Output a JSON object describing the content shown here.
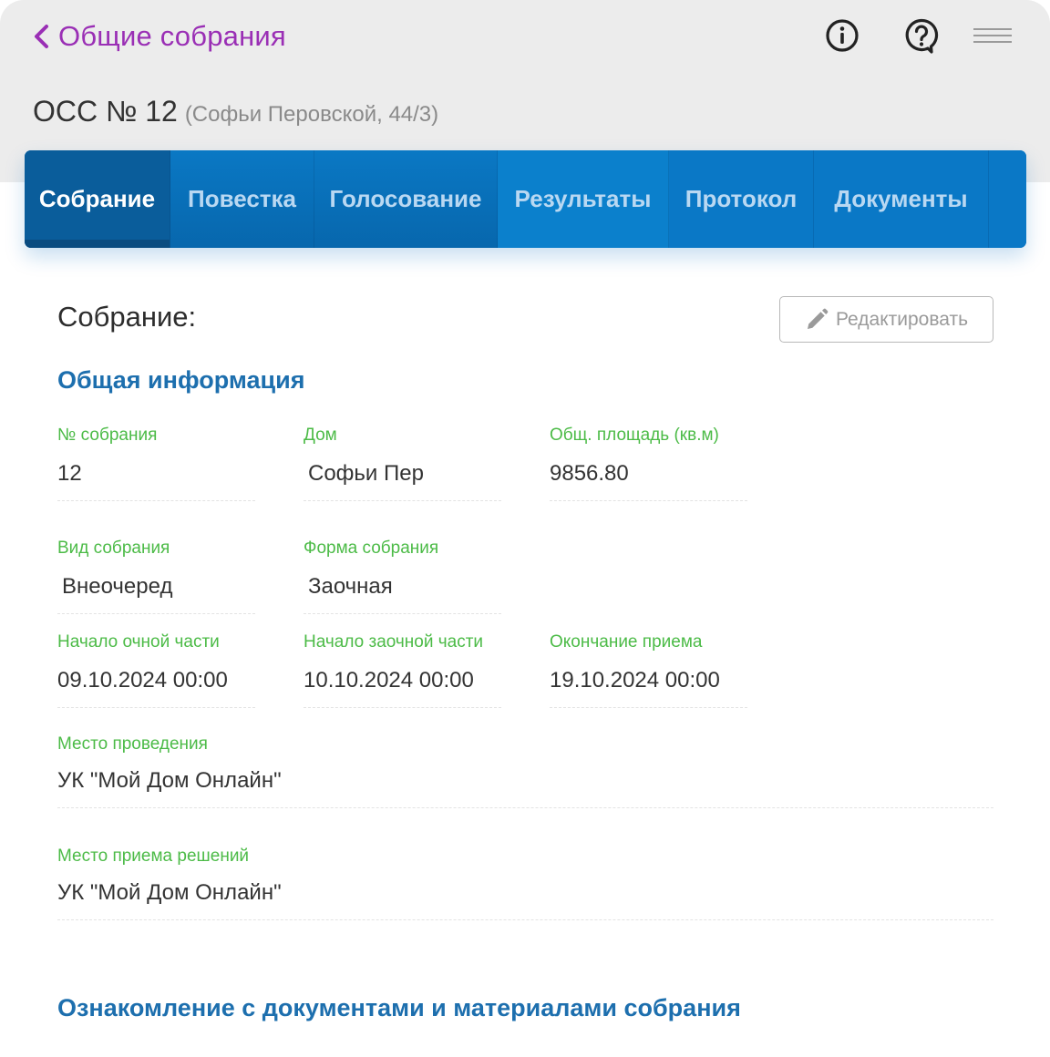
{
  "header": {
    "back_label": "Общие собрания",
    "icons": [
      "chevron-left-icon",
      "info-icon",
      "help-icon",
      "menu-icon"
    ]
  },
  "page": {
    "title": "ОСС № 12",
    "subtitle": "(Софьи Перовской, 44/3)"
  },
  "tabs": [
    {
      "label": "Собрание",
      "active": true
    },
    {
      "label": "Повестка",
      "active": false
    },
    {
      "label": "Голосование",
      "active": false
    },
    {
      "label": "Результаты",
      "active": false
    },
    {
      "label": "Протокол",
      "active": false
    },
    {
      "label": "Документы",
      "active": false
    }
  ],
  "main": {
    "section_title": "Собрание:",
    "edit_label": "Редактировать",
    "general_heading": "Общая информация",
    "fields": {
      "number": {
        "label": "№ собрания",
        "value": "12"
      },
      "house": {
        "label": "Дом",
        "value": "Софьи Пер"
      },
      "area": {
        "label": "Общ. площадь (кв.м)",
        "value": "9856.80"
      },
      "kind": {
        "label": "Вид собрания",
        "value": "Внеочеред"
      },
      "form": {
        "label": "Форма собрания",
        "value": "Заочная"
      },
      "start_in_person": {
        "label": "Начало очной части",
        "value": "09.10.2024 00:00"
      },
      "start_absentee": {
        "label": "Начало заочной части",
        "value": "10.10.2024 00:00"
      },
      "end_reception": {
        "label": "Окончание приема",
        "value": "19.10.2024 00:00"
      },
      "venue": {
        "label": "Место проведения",
        "value": "УК \"Мой Дом Онлайн\""
      },
      "decision_place": {
        "label": "Место приема решений",
        "value": "УК \"Мой Дом Онлайн\""
      }
    },
    "docs_heading": "Ознакомление с документами и материалами собрания"
  },
  "colors": {
    "accent_purple": "#9a2fb5",
    "tab_blue": "#0a78c4",
    "heading_blue": "#1d6fae",
    "label_green": "#4cbb47"
  }
}
